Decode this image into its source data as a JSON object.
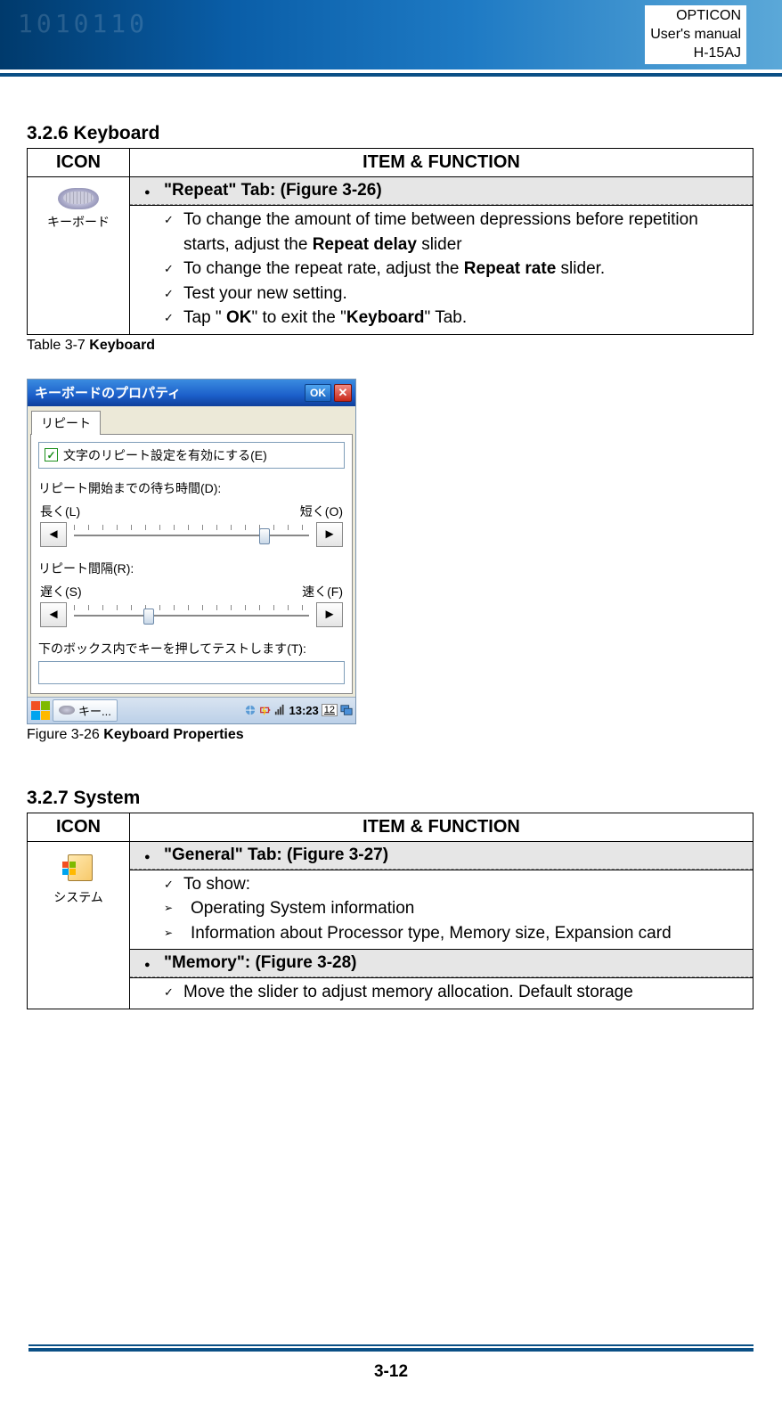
{
  "header": {
    "line1": "OPTICON",
    "line2": "User's manual",
    "line3": "H-15AJ"
  },
  "section1": {
    "heading": "3.2.6 Keyboard",
    "table": {
      "col_icon": "ICON",
      "col_func": "ITEM & FUNCTION",
      "icon_label": "キーボード",
      "tab_heading": "\"Repeat\" Tab: (Figure 3-26)",
      "items": {
        "i1_pre": "To change the amount of time between depressions before repetition starts, adjust the ",
        "i1_bold": "Repeat delay",
        "i1_post": " slider",
        "i2_pre": "To change the repeat rate, adjust the ",
        "i2_bold": "Repeat rate",
        "i2_post": " slider.",
        "i3": "Test your new setting.",
        "i4_pre": "Tap \" ",
        "i4_b1": "OK",
        "i4_mid": "\" to exit the \"",
        "i4_b2": "Keyboard",
        "i4_post": "\" Tab."
      }
    },
    "caption_pre": "Table 3-7 ",
    "caption_bold": "Keyboard"
  },
  "mock": {
    "title": "キーボードのプロパティ",
    "ok": "OK",
    "tab": "リピート",
    "enable": "文字のリピート設定を有効にする(E)",
    "delay_label": "リピート開始までの待ち時間(D):",
    "long": "長く(L)",
    "short": "短く(O)",
    "rate_label": "リピート間隔(R):",
    "slow": "遅く(S)",
    "fast": "速く(F)",
    "test_label": "下のボックス内でキーを押してテストします(T):",
    "task_label": "キー...",
    "clock": "13:23",
    "sip_badge": "12"
  },
  "fig_caption_pre": "Figure 3-26 ",
  "fig_caption_bold": "Keyboard Properties",
  "section2": {
    "heading": "3.2.7 System",
    "table": {
      "col_icon": "ICON",
      "col_func": "ITEM & FUNCTION",
      "icon_label": "システム",
      "tab1_heading": "\"General\" Tab: (Figure 3-27)",
      "show_label": "To show:",
      "show_item1": "Operating System information",
      "show_item2": "Information about Processor type, Memory size, Expansion card",
      "tab2_heading": "\"Memory\": (Figure 3-28)",
      "mem_item": "Move the slider to adjust memory allocation. Default storage"
    }
  },
  "page_number": "3-12"
}
